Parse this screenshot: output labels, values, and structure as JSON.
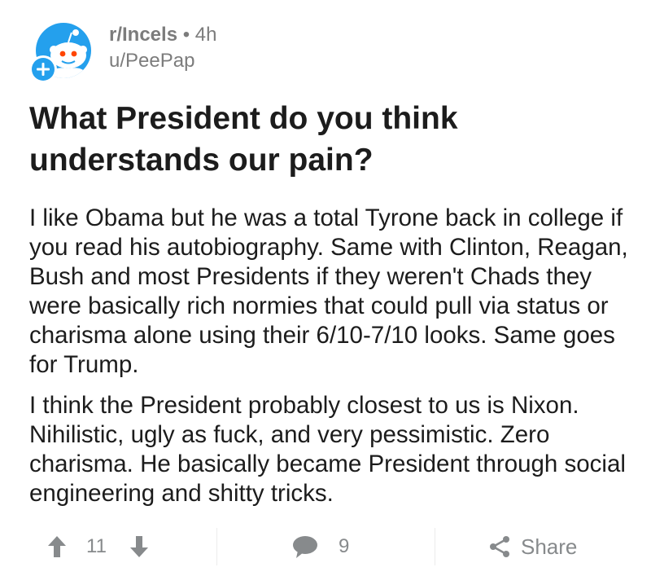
{
  "post": {
    "subreddit": "r/Incels",
    "separator": "•",
    "age": "4h",
    "author": "u/PeePap",
    "title": "What President do you think understands our pain?",
    "paragraphs": [
      "I like Obama but he was a total Tyrone back in college if you read his autobiography. Same with Clinton, Reagan, Bush and most Presidents if they weren't Chads they were basically rich normies that could pull via status or charisma alone using their 6/10-7/10 looks. Same goes for Trump.",
      "I think the President probably closest to us is Nixon. Nihilistic, ugly as fuck, and very pessimistic. Zero charisma. He basically became President through social engineering and shitty tricks."
    ]
  },
  "footer": {
    "score": "11",
    "comments": "9",
    "share_label": "Share"
  },
  "icons": {
    "avatar": "reddit-snoo-icon",
    "join": "plus-icon",
    "upvote": "arrow-up-icon",
    "downvote": "arrow-down-icon",
    "comment": "comment-bubble-icon",
    "share": "share-icon"
  },
  "colors": {
    "brand_blue": "#24a0ed",
    "muted_text": "#7c7c7c",
    "icon_gray": "#878a8c",
    "text": "#1c1c1c"
  }
}
